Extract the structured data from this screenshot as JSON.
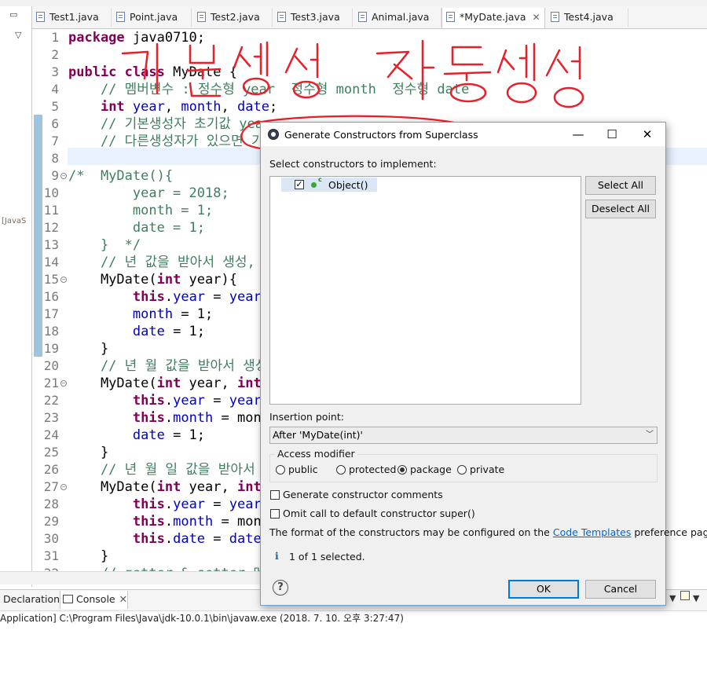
{
  "editor_tabs": [
    {
      "label": "Test1.java"
    },
    {
      "label": "Point.java"
    },
    {
      "label": "Test2.java"
    },
    {
      "label": "Test3.java"
    },
    {
      "label": "Animal.java"
    },
    {
      "label": "*MyDate.java",
      "active": true,
      "close": "✕"
    },
    {
      "label": "Test4.java"
    }
  ],
  "left_panel": {
    "collapse_icon": "▭",
    "menu_icon": "▽",
    "truncated_label": "[JavaS",
    "scroll_left": "‹",
    "scroll_right": "›"
  },
  "code_lines": [
    {
      "n": "1",
      "text": "package java0710;"
    },
    {
      "n": "2",
      "text": ""
    },
    {
      "n": "3",
      "text": "public class MyDate {"
    },
    {
      "n": "4",
      "text": "    // 멤버변수 : 정수형 year  정수형 month  정수형 date"
    },
    {
      "n": "5",
      "text": "    int year, month, date;"
    },
    {
      "n": "6",
      "text": "    // 기본생성자 초기값 yea"
    },
    {
      "n": "7",
      "text": "    // 다른생성자가 있으면 기본"
    },
    {
      "n": "8",
      "text": ""
    },
    {
      "n": "9",
      "text": "/*  MyDate(){"
    },
    {
      "n": "10",
      "text": "        year = 2018;"
    },
    {
      "n": "11",
      "text": "        month = 1;"
    },
    {
      "n": "12",
      "text": "        date = 1;"
    },
    {
      "n": "13",
      "text": "    }  */"
    },
    {
      "n": "14",
      "text": "    // 년 값을 받아서 생성, 월"
    },
    {
      "n": "15",
      "text": "    MyDate(int year){"
    },
    {
      "n": "16",
      "text": "        this.year = year;"
    },
    {
      "n": "17",
      "text": "        month = 1;"
    },
    {
      "n": "18",
      "text": "        date = 1;"
    },
    {
      "n": "19",
      "text": "    }"
    },
    {
      "n": "20",
      "text": "    // 년 월 값을 받아서 생성,"
    },
    {
      "n": "21",
      "text": "    MyDate(int year, int"
    },
    {
      "n": "22",
      "text": "        this.year = year;"
    },
    {
      "n": "23",
      "text": "        this.month = mont"
    },
    {
      "n": "24",
      "text": "        date = 1;"
    },
    {
      "n": "25",
      "text": "    }"
    },
    {
      "n": "26",
      "text": "    // 년 월 일 값을 받아서 생성"
    },
    {
      "n": "27",
      "text": "    MyDate(int year, int"
    },
    {
      "n": "28",
      "text": "        this.year = year;"
    },
    {
      "n": "29",
      "text": "        this.month = mont"
    },
    {
      "n": "30",
      "text": "        this.date = date;"
    },
    {
      "n": "31",
      "text": "    }"
    },
    {
      "n": "32",
      "text": "    // getter & setter 메"
    }
  ],
  "handwriting": {
    "text": "기본 생성자 자동생성",
    "color": "#e8202a"
  },
  "bottom": {
    "declaration_tab": "Declaration",
    "console_tab": "Console",
    "console_close": "✕",
    "console_text": "Application] C:\\Program Files\\Java\\jdk-10.0.1\\bin\\javaw.exe (2018. 7. 10. 오후 3:27:47)"
  },
  "dialog": {
    "title": "Generate Constructors from Superclass",
    "minimize": "—",
    "maximize": "☐",
    "close": "✕",
    "select_label": "Select constructors to implement:",
    "constructors": [
      {
        "label": "Object()",
        "checked": true
      }
    ],
    "select_all": "Select All",
    "deselect_all": "Deselect All",
    "insertion_label": "Insertion point:",
    "insertion_value": "After 'MyDate(int)'",
    "access_label": "Access modifier",
    "access_options": [
      "public",
      "protected",
      "package",
      "private"
    ],
    "access_selected": "package",
    "gen_comments": "Generate constructor comments",
    "gen_comments_checked": false,
    "omit_super": "Omit call to default constructor super()",
    "omit_super_checked": false,
    "format_prefix": "The format of the constructors may be configured on the",
    "format_link": "Code Templates",
    "format_suffix": "preference page.",
    "status_text": "1 of 1 selected.",
    "ok": "OK",
    "cancel": "Cancel"
  },
  "colors": {
    "keyword": "#7f0055",
    "field": "#0000c0",
    "comment": "#3f7f5f",
    "annotation": "#e8202a",
    "dialog_border": "#6e9fd0"
  }
}
